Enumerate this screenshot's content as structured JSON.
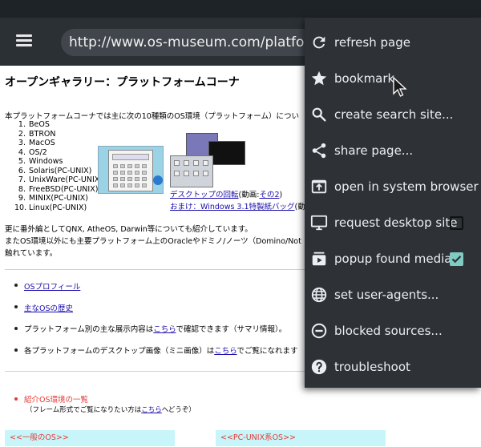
{
  "browser": {
    "url": "http://www.os-museum.com/platform.h"
  },
  "page": {
    "title": "オープンギャラリー：プラットフォームコーナ",
    "intro": "本プラットフォームコーナでは主に次の10種類のOS環境（プラットフォーム）につい",
    "os_list": [
      {
        "num": "1.",
        "name": "BeOS"
      },
      {
        "num": "2.",
        "name": "BTRON"
      },
      {
        "num": "3.",
        "name": "MacOS"
      },
      {
        "num": "4.",
        "name": "OS/2"
      },
      {
        "num": "5.",
        "name": "Windows"
      },
      {
        "num": "6.",
        "name": "Solaris(PC-UNIX)"
      },
      {
        "num": "7.",
        "name": "UnixWare(PC-UNIX)"
      },
      {
        "num": "8.",
        "name": "FreeBSD(PC-UNIX)"
      },
      {
        "num": "9.",
        "name": "MINIX(PC-UNIX)"
      },
      {
        "num": "10.",
        "name": "Linux(PC-UNIX)"
      }
    ],
    "desktop_link_text": "デスクトップの回転",
    "desktop_paren_prefix": "(動画:",
    "desktop_paren_link": "その2",
    "desktop_paren_suffix": ")",
    "bonus_link_text": "おまけ：Windows 3.1特製紙バッグ",
    "bonus_suffix": "(動",
    "para_line1": "更に番外編としてQNX, AtheOS, Darwin等についても紹介しています。",
    "para_line2": "またOS環境以外にも主要プラットフォーム上のOracleやドミノ/ノーツ（Domino/Not",
    "para_line3": "触れています。",
    "links": [
      {
        "text": "OSプロフィール"
      },
      {
        "text": "主なOSの歴史"
      }
    ],
    "summary_prefix": "プラットフォーム別の主な展示内容は",
    "summary_link": "こちら",
    "summary_suffix": "で確認できます（サマリ情報）。",
    "desktop_img_prefix": "各プラットフォームのデスクトップ画像（ミニ画像）は",
    "desktop_img_link": "こちら",
    "desktop_img_suffix": "でご覧になれます",
    "intro_list_title": "紹介OS環境の一覧",
    "frame_note_prefix": "（フレーム形式でご覧になりたい方は",
    "frame_note_link": "こちら",
    "frame_note_suffix": "へどうぞ）",
    "box_general": "<<一般のOS>>",
    "box_pcunix": "<<PC-UNIX系OS>>"
  },
  "menu": {
    "items": [
      {
        "label": "refresh page",
        "icon": "refresh-icon"
      },
      {
        "label": "bookmark",
        "icon": "star-icon"
      },
      {
        "label": "create search site...",
        "icon": "search-icon"
      },
      {
        "label": "share page...",
        "icon": "share-icon"
      },
      {
        "label": "open in system browser",
        "icon": "open-external-icon"
      },
      {
        "label": "request desktop site",
        "icon": "desktop-icon",
        "checkbox": false
      },
      {
        "label": "popup found medias",
        "icon": "media-icon",
        "checkbox": true
      },
      {
        "label": "set user-agents...",
        "icon": "globe-icon"
      },
      {
        "label": "blocked sources...",
        "icon": "block-icon"
      },
      {
        "label": "troubleshoot",
        "icon": "help-icon"
      }
    ]
  },
  "colors": {
    "app_bar": "#2b3035",
    "menu_bg": "#2e3237",
    "checkbox_on": "#80cbc4",
    "link": "#1a0dab",
    "highlight_red": "#e53935",
    "section_box": "#c8f5f9"
  }
}
